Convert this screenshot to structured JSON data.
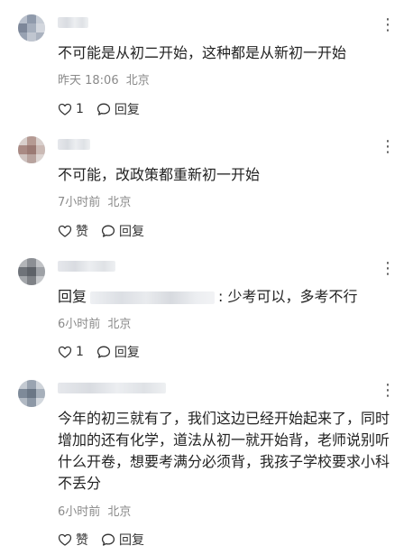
{
  "comments": [
    {
      "text": "不可能是从初二开始，这种都是从新初一开始",
      "time": "昨天 18:06",
      "location": "北京",
      "like_label": "1",
      "reply_label": "回复"
    },
    {
      "text": "不可能，改政策都重新初一开始",
      "time": "7小时前",
      "location": "北京",
      "like_label": "赞",
      "reply_label": "回复"
    },
    {
      "reply_prefix": "回复",
      "text": ": 少考可以，多考不行",
      "time": "6小时前",
      "location": "北京",
      "like_label": "1",
      "reply_label": "回复"
    },
    {
      "text": "今年的初三就有了，我们这边已经开始起来了，同时增加的还有化学，道法从初一就开始背，老师说别听什么开卷，想要考满分必须背，我孩子学校要求小科不丢分",
      "time": "6小时前",
      "location": "北京",
      "like_label": "赞",
      "reply_label": "回复"
    }
  ],
  "icons": {
    "more": "more-vertical-icon",
    "like": "heart-icon",
    "reply": "speech-bubble-icon"
  },
  "colors": {
    "text": "#222222",
    "meta": "#8a8a8a",
    "icon": "#333333"
  }
}
